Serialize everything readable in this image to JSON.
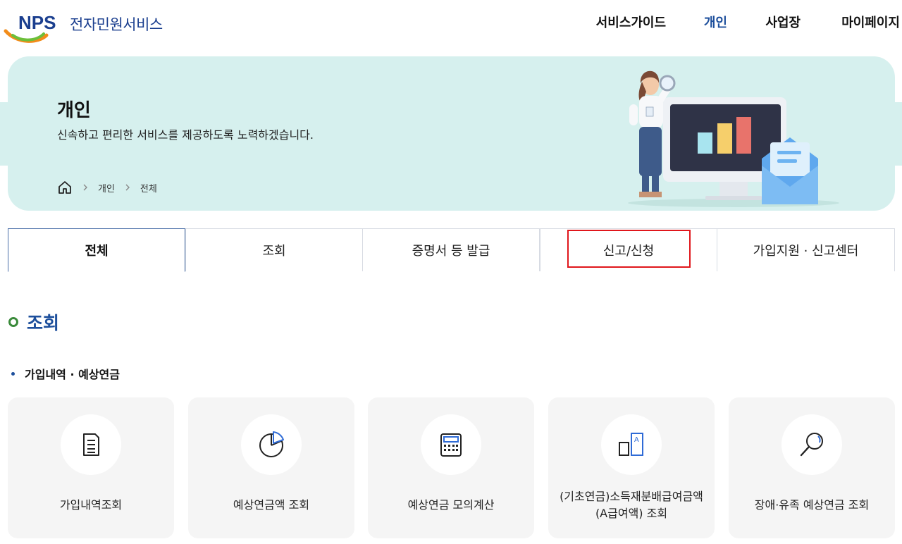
{
  "header": {
    "logo_mark": "NPS",
    "logo_text": "전자민원서비스",
    "nav": [
      {
        "label": "서비스가이드",
        "active": false
      },
      {
        "label": "개인",
        "active": true
      },
      {
        "label": "사업장",
        "active": false
      },
      {
        "label": "마이페이지",
        "active": false
      }
    ]
  },
  "hero": {
    "title": "개인",
    "subtitle": "신속하고 편리한 서비스를 제공하도록 노력하겠습니다.",
    "breadcrumb": [
      "개인",
      "전체"
    ]
  },
  "tabs": [
    {
      "label": "전체",
      "active": true
    },
    {
      "label": "조회",
      "active": false
    },
    {
      "label": "증명서 등 발급",
      "active": false
    },
    {
      "label": "신고/신청",
      "active": false,
      "highlighted": true
    },
    {
      "label": "가입지원 · 신고센터",
      "active": false
    }
  ],
  "section": {
    "title": "조회",
    "subsection": "가입내역 · 예상연금",
    "cards": [
      {
        "label": "가입내역조회",
        "icon": "document-icon"
      },
      {
        "label": "예상연금액 조회",
        "icon": "pie-chart-icon"
      },
      {
        "label": "예상연금 모의계산",
        "icon": "calculator-icon"
      },
      {
        "label": "(기초연금)소득재분배급여금액(A급여액) 조회",
        "icon": "a-value-icon"
      },
      {
        "label": "장애·유족 예상연금 조회",
        "icon": "magnifier-icon"
      }
    ]
  },
  "colors": {
    "brand_blue": "#1d4f9c",
    "hero_bg": "#d6f0ee",
    "highlight_red": "#e0161b",
    "card_bg": "#f5f5f5"
  }
}
